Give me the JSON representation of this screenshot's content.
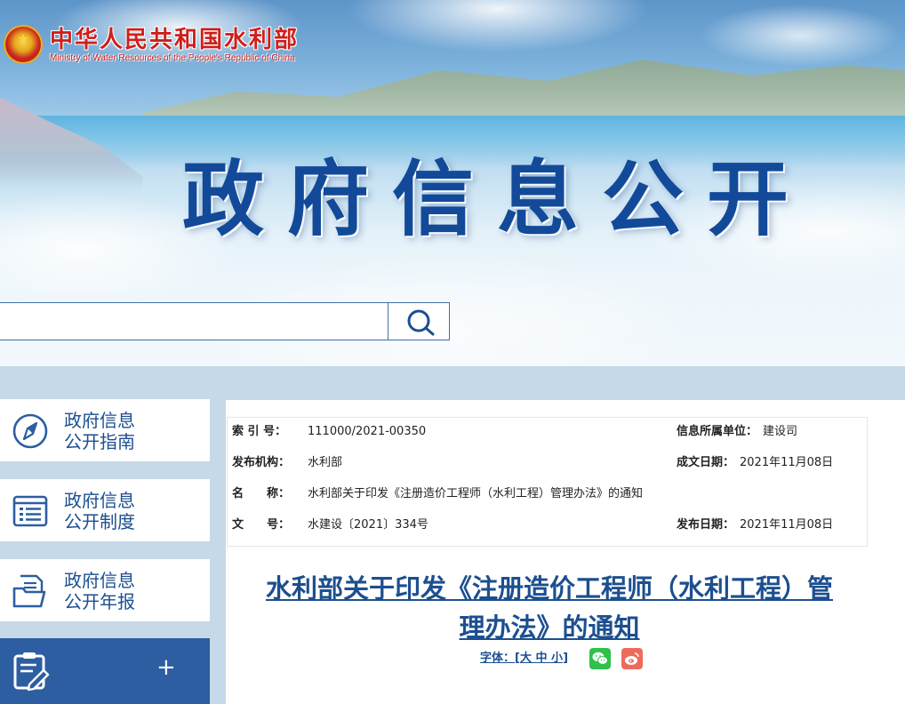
{
  "header": {
    "org_name_cn": "中华人民共和国水利部",
    "org_name_en": "Ministry of Water Resources of the People's Republic of China",
    "banner_title": "政府信息公开",
    "search": {
      "placeholder": "",
      "value": "",
      "icon": "search-icon"
    }
  },
  "sidebar": {
    "items": [
      {
        "label_line1": "政府信息",
        "label_line2": "公开指南",
        "icon": "compass-icon"
      },
      {
        "label_line1": "政府信息",
        "label_line2": "公开制度",
        "icon": "list-icon"
      },
      {
        "label_line1": "政府信息",
        "label_line2": "公开年报",
        "icon": "folder-icon"
      }
    ],
    "active": {
      "icon": "clipboard-edit-icon",
      "toggle": "+"
    }
  },
  "meta": {
    "index_label": "索 引 号：",
    "index_value": "111000/2021-00350",
    "dept_label": "信息所属单位：",
    "dept_value": "建设司",
    "issuer_label": "发布机构：",
    "issuer_value": "水利部",
    "created_label": "成文日期：",
    "created_value": "2021年11月08日",
    "name_label": "名　　称：",
    "name_value": "水利部关于印发《注册造价工程师（水利工程）管理办法》的通知",
    "docno_label": "文　　号：",
    "docno_value": "水建设〔2021〕334号",
    "published_label": "发布日期：",
    "published_value": "2021年11月08日"
  },
  "article": {
    "title_line1": "水利部关于印发《注册造价工程师（水利工程）管",
    "title_line2": "理办法》的通知",
    "font_label": "字体：[",
    "font_large": "大",
    "font_medium": "中",
    "font_small": "小",
    "font_close": "]"
  },
  "colors": {
    "brand_red": "#cf1f1a",
    "brand_blue": "#1c4f8f",
    "title_blue": "#124a99",
    "sidebar_active": "#2c5ea1",
    "page_bg": "#c6d9e8",
    "wechat_green": "#2ec24a",
    "weibo_red": "#ee6b5c"
  }
}
